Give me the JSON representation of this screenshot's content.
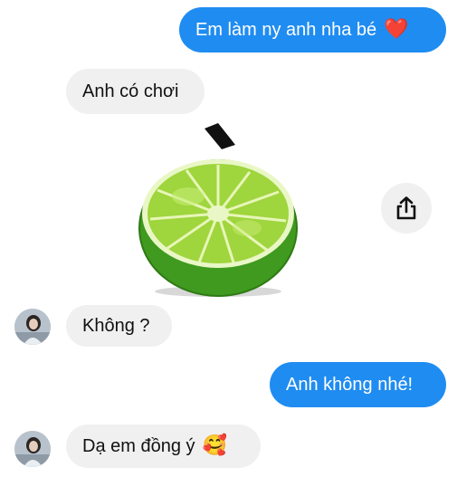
{
  "messages": [
    {
      "id": "msg1",
      "direction": "outgoing",
      "text": "Em làm ny anh nha bé",
      "emoji": "❤️"
    },
    {
      "id": "msg2",
      "direction": "incoming",
      "text": "Anh có chơi"
    },
    {
      "id": "msg3",
      "direction": "incoming",
      "text": "Không ?"
    },
    {
      "id": "msg4",
      "direction": "outgoing",
      "text": "Anh không nhé!"
    },
    {
      "id": "msg5",
      "direction": "incoming",
      "text": "Dạ em đồng ý",
      "emoji": "🥰"
    }
  ],
  "sticker": {
    "icon": "lime-half-sticker"
  },
  "actions": {
    "share_icon": "share-icon"
  },
  "colors": {
    "outgoing_bubble": "#1f8cf1",
    "incoming_bubble": "#f0f0f1",
    "outgoing_text": "#ffffff",
    "incoming_text": "#111111"
  }
}
